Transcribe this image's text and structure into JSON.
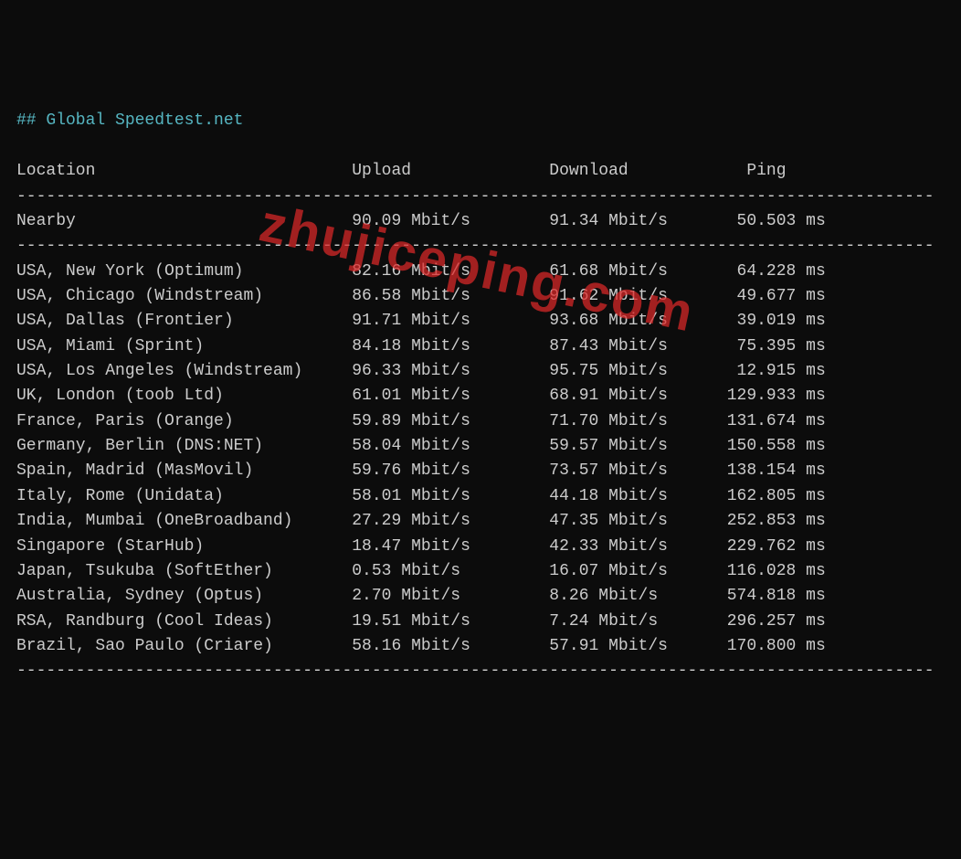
{
  "title": "## Global Speedtest.net",
  "headers": {
    "location": "Location",
    "upload": "Upload",
    "download": "Download",
    "ping": "Ping"
  },
  "nearby": {
    "location": "Nearby",
    "upload": "90.09 Mbit/s",
    "download": "91.34 Mbit/s",
    "ping": "50.503 ms"
  },
  "rows": [
    {
      "location": "USA, New York (Optimum)",
      "upload": "82.16 Mbit/s",
      "download": "61.68 Mbit/s",
      "ping": "64.228 ms"
    },
    {
      "location": "USA, Chicago (Windstream)",
      "upload": "86.58 Mbit/s",
      "download": "91.62 Mbit/s",
      "ping": "49.677 ms"
    },
    {
      "location": "USA, Dallas (Frontier)",
      "upload": "91.71 Mbit/s",
      "download": "93.68 Mbit/s",
      "ping": "39.019 ms"
    },
    {
      "location": "USA, Miami (Sprint)",
      "upload": "84.18 Mbit/s",
      "download": "87.43 Mbit/s",
      "ping": "75.395 ms"
    },
    {
      "location": "USA, Los Angeles (Windstream)",
      "upload": "96.33 Mbit/s",
      "download": "95.75 Mbit/s",
      "ping": "12.915 ms"
    },
    {
      "location": "UK, London (toob Ltd)",
      "upload": "61.01 Mbit/s",
      "download": "68.91 Mbit/s",
      "ping": "129.933 ms"
    },
    {
      "location": "France, Paris (Orange)",
      "upload": "59.89 Mbit/s",
      "download": "71.70 Mbit/s",
      "ping": "131.674 ms"
    },
    {
      "location": "Germany, Berlin (DNS:NET)",
      "upload": "58.04 Mbit/s",
      "download": "59.57 Mbit/s",
      "ping": "150.558 ms"
    },
    {
      "location": "Spain, Madrid (MasMovil)",
      "upload": "59.76 Mbit/s",
      "download": "73.57 Mbit/s",
      "ping": "138.154 ms"
    },
    {
      "location": "Italy, Rome (Unidata)",
      "upload": "58.01 Mbit/s",
      "download": "44.18 Mbit/s",
      "ping": "162.805 ms"
    },
    {
      "location": "India, Mumbai (OneBroadband)",
      "upload": "27.29 Mbit/s",
      "download": "47.35 Mbit/s",
      "ping": "252.853 ms"
    },
    {
      "location": "Singapore (StarHub)",
      "upload": "18.47 Mbit/s",
      "download": "42.33 Mbit/s",
      "ping": "229.762 ms"
    },
    {
      "location": "Japan, Tsukuba (SoftEther)",
      "upload": "0.53 Mbit/s",
      "download": "16.07 Mbit/s",
      "ping": "116.028 ms"
    },
    {
      "location": "Australia, Sydney (Optus)",
      "upload": "2.70 Mbit/s",
      "download": "8.26 Mbit/s",
      "ping": "574.818 ms"
    },
    {
      "location": "RSA, Randburg (Cool Ideas)",
      "upload": "19.51 Mbit/s",
      "download": "7.24 Mbit/s",
      "ping": "296.257 ms"
    },
    {
      "location": "Brazil, Sao Paulo (Criare)",
      "upload": "58.16 Mbit/s",
      "download": "57.91 Mbit/s",
      "ping": "170.800 ms"
    }
  ],
  "watermark": "zhujiceping.com",
  "chart_data": {
    "type": "table",
    "title": "Global Speedtest.net",
    "columns": [
      "Location",
      "Upload (Mbit/s)",
      "Download (Mbit/s)",
      "Ping (ms)"
    ],
    "rows": [
      [
        "Nearby",
        90.09,
        91.34,
        50.503
      ],
      [
        "USA, New York (Optimum)",
        82.16,
        61.68,
        64.228
      ],
      [
        "USA, Chicago (Windstream)",
        86.58,
        91.62,
        49.677
      ],
      [
        "USA, Dallas (Frontier)",
        91.71,
        93.68,
        39.019
      ],
      [
        "USA, Miami (Sprint)",
        84.18,
        87.43,
        75.395
      ],
      [
        "USA, Los Angeles (Windstream)",
        96.33,
        95.75,
        12.915
      ],
      [
        "UK, London (toob Ltd)",
        61.01,
        68.91,
        129.933
      ],
      [
        "France, Paris (Orange)",
        59.89,
        71.7,
        131.674
      ],
      [
        "Germany, Berlin (DNS:NET)",
        58.04,
        59.57,
        150.558
      ],
      [
        "Spain, Madrid (MasMovil)",
        59.76,
        73.57,
        138.154
      ],
      [
        "Italy, Rome (Unidata)",
        58.01,
        44.18,
        162.805
      ],
      [
        "India, Mumbai (OneBroadband)",
        27.29,
        47.35,
        252.853
      ],
      [
        "Singapore (StarHub)",
        18.47,
        42.33,
        229.762
      ],
      [
        "Japan, Tsukuba (SoftEther)",
        0.53,
        16.07,
        116.028
      ],
      [
        "Australia, Sydney (Optus)",
        2.7,
        8.26,
        574.818
      ],
      [
        "RSA, Randburg (Cool Ideas)",
        19.51,
        7.24,
        296.257
      ],
      [
        "Brazil, Sao Paulo (Criare)",
        58.16,
        57.91,
        170.8
      ]
    ]
  }
}
